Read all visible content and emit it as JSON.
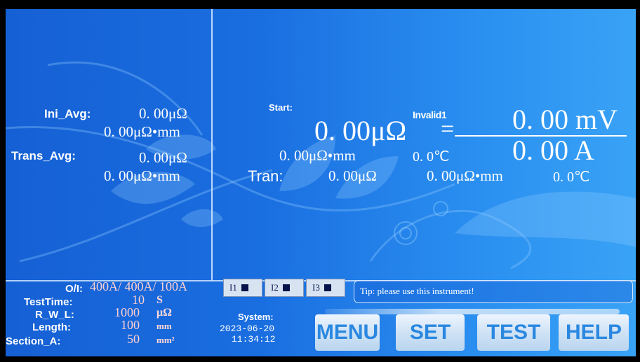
{
  "left_panel": {
    "ini_avg_label": "Ini_Avg:",
    "ini_avg_value": "0. 00μΩ",
    "ini_avg_resistivity": "0. 00μΩ•mm",
    "trans_avg_label": "Trans_Avg:",
    "trans_avg_value": "0. 00μΩ",
    "trans_avg_resistivity": "0. 00μΩ•mm"
  },
  "main": {
    "start_label": "Start:",
    "status": "Invalid1",
    "resistance": "0. 00μΩ",
    "equals": "=",
    "voltage": "0. 00 mV",
    "current": "0. 00 A",
    "resistivity": "0. 00μΩ•mm",
    "temperature": "0. 0℃",
    "tran_label": "Tran:",
    "tran_resistance": "0. 00μΩ",
    "tran_resistivity": "0. 00μΩ•mm",
    "tran_temperature": "0. 0℃"
  },
  "params": {
    "oi_label": "O/I:",
    "oi_value": "400A/ 400A/ 100A",
    "testtime_label": "TestTime:",
    "testtime_value": "10",
    "testtime_unit": "S",
    "rwl_label": "R_W_L:",
    "rwl_value": "1000",
    "rwl_unit": "μΩ",
    "length_label": "Length:",
    "length_value": "100",
    "length_unit": "mm",
    "section_label": "Section_A:",
    "section_value": "50",
    "section_unit": "mm²"
  },
  "channels": [
    "I1",
    "I2",
    "I3"
  ],
  "tip": "Tip: please use this instrument!",
  "system": {
    "label": "System:",
    "date": "2023-06-20",
    "time": "11:34:12"
  },
  "buttons": {
    "menu": "MENU",
    "set": "SET",
    "test": "TEST",
    "help": "HELP"
  },
  "colors": {
    "background": "#1a6ee0",
    "button_text": "#2a88e0",
    "param_value": "#ffd0d0"
  }
}
